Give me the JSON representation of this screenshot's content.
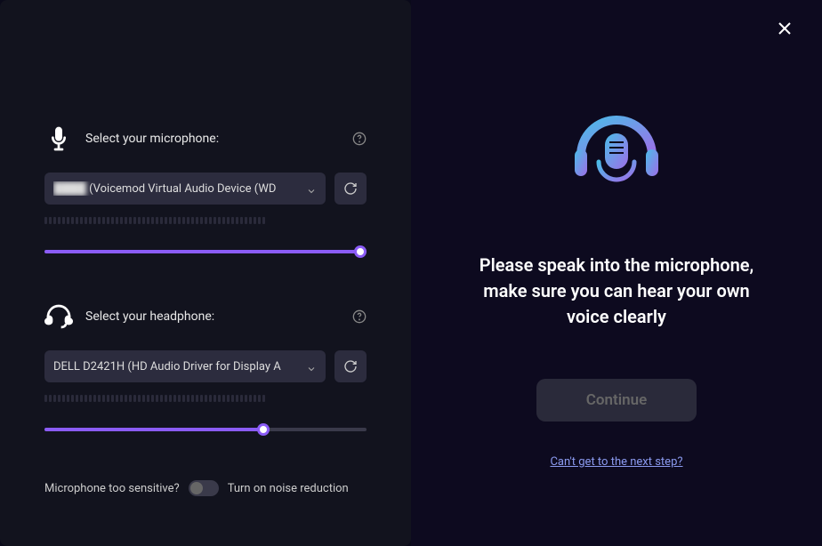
{
  "left": {
    "mic": {
      "label": "Select your microphone:",
      "device_blurred": "████",
      "device_visible": "(Voicemod Virtual Audio Device (WD",
      "slider_percent": 98
    },
    "headphone": {
      "label": "Select your headphone:",
      "device": "DELL D2421H (HD Audio Driver for Display A",
      "slider_percent": 68
    },
    "noise": {
      "question": "Microphone too sensitive?",
      "action": "Turn on noise reduction",
      "enabled": false
    }
  },
  "right": {
    "instruction": "Please speak into the microphone, make sure you can hear your own voice clearly",
    "continue_label": "Continue",
    "help_link": "Can't get to the next step?"
  }
}
